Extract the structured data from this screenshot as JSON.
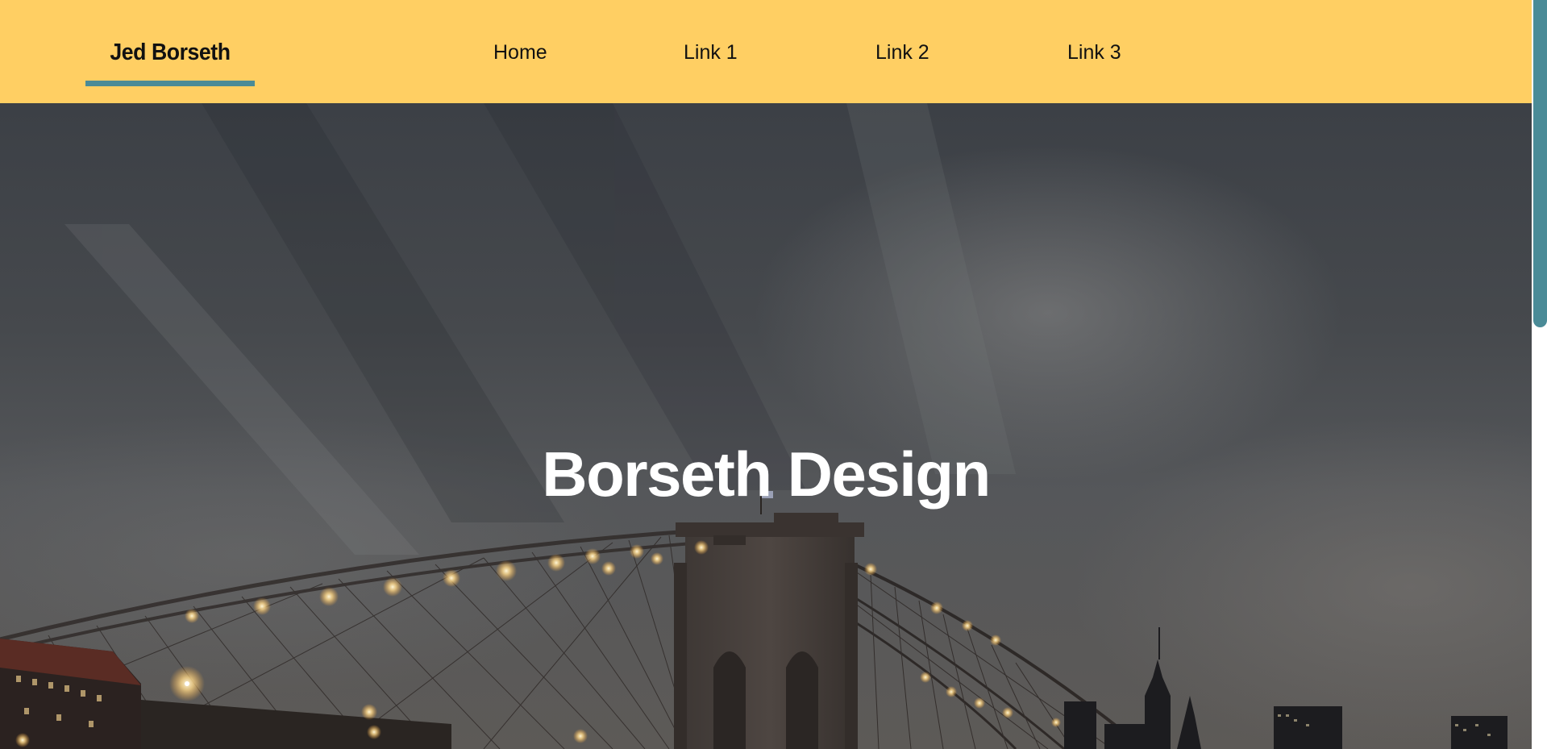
{
  "navbar": {
    "brand": "Jed Borseth",
    "links": [
      {
        "label": "Home"
      },
      {
        "label": "Link 1"
      },
      {
        "label": "Link 2"
      },
      {
        "label": "Link 3"
      }
    ]
  },
  "hero": {
    "title": "Borseth Design",
    "background_image": "brooklyn-bridge-night"
  },
  "colors": {
    "navbar_bg": "#ffcf63",
    "accent": "#4a8b97",
    "hero_text": "#ffffff"
  }
}
